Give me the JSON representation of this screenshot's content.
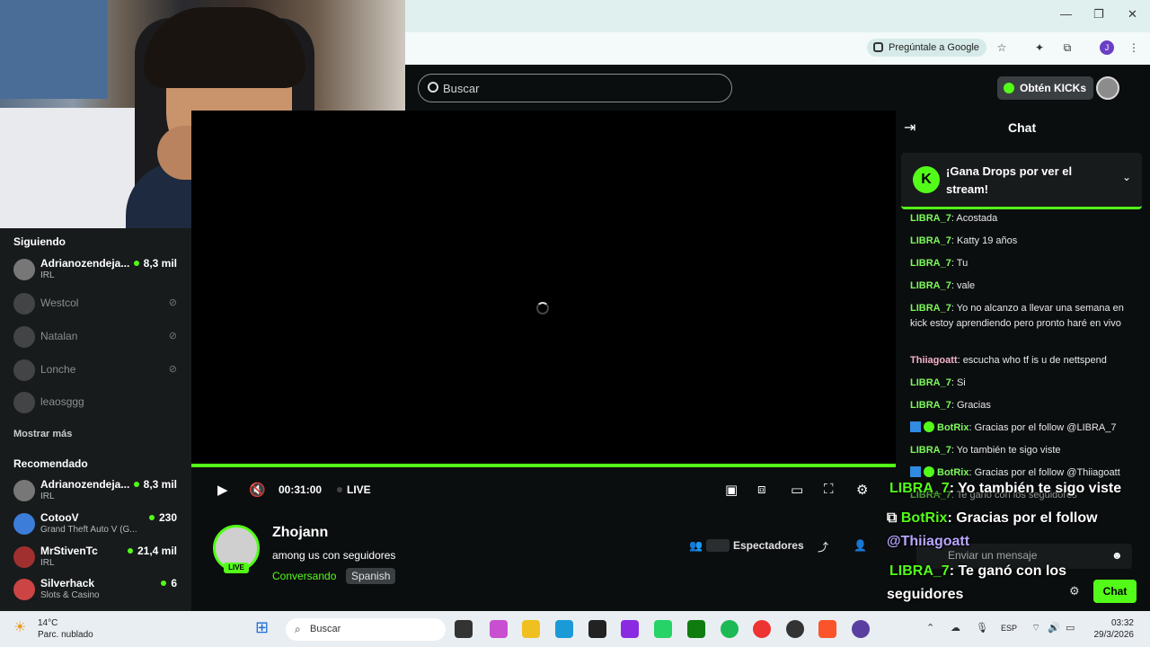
{
  "browser": {
    "ask_google": "Pregúntale a Google",
    "profile_initial": "J"
  },
  "topnav": {
    "search_placeholder": "Buscar",
    "kicks_button": "Obtén KICKs"
  },
  "sidebar": {
    "following_title": "Siguiendo",
    "following": [
      {
        "name": "Adrianozendeja...",
        "category": "IRL",
        "viewers": "8,3 mil",
        "live": true
      },
      {
        "name": "Westcol",
        "live": false
      },
      {
        "name": "Natalan",
        "live": false
      },
      {
        "name": "Lonche",
        "live": false
      },
      {
        "name": "leaosggg",
        "live": false
      }
    ],
    "show_more": "Mostrar más",
    "recommended_title": "Recomendado",
    "recommended": [
      {
        "name": "Adrianozendeja...",
        "category": "IRL",
        "viewers": "8,3 mil"
      },
      {
        "name": "CotooV",
        "category": "Grand Theft Auto V (G...",
        "viewers": "230"
      },
      {
        "name": "MrStivenTc",
        "category": "IRL",
        "viewers": "21,4 mil"
      },
      {
        "name": "Silverhack",
        "category": "Slots & Casino",
        "viewers": "6"
      }
    ]
  },
  "player": {
    "time": "00:31:00",
    "live_label": "LIVE",
    "progress": 1.0
  },
  "stream": {
    "streamer": "Zhojann",
    "live_badge": "LIVE",
    "title": "among us con seguidores",
    "category": "Conversando",
    "language": "Spanish",
    "viewers_label": "Espectadores"
  },
  "chat": {
    "title": "Chat",
    "drops_text": "¡Gana Drops por ver el stream!",
    "messages": [
      {
        "user": "LIBRA_7",
        "text": "Acostada"
      },
      {
        "user": "LIBRA_7",
        "text": "Katty 19 años"
      },
      {
        "user": "LIBRA_7",
        "text": "Tu"
      },
      {
        "user": "LIBRA_7",
        "text": "vale"
      },
      {
        "user": "LIBRA_7",
        "text": "Yo no alcanzo a llevar una semana en kick estoy aprendiendo pero pronto haré en vivo"
      },
      {
        "user": "Thiiagoatt",
        "text": "escucha who tf is u de nettspend"
      },
      {
        "user": "LIBRA_7",
        "text": "Si"
      },
      {
        "user": "LIBRA_7",
        "text": "Gracias"
      },
      {
        "user": "BotRix",
        "text": "Gracias por el follow @LIBRA_7"
      },
      {
        "user": "LIBRA_7",
        "text": "Yo también te sigo viste"
      },
      {
        "user": "BotRix",
        "text": "Gracias por el follow @Thiiagoatt"
      },
      {
        "user": "LIBRA_7",
        "text": "Te ganó con los seguidores"
      }
    ],
    "input_placeholder": "Enviar un mensaje",
    "send_button": "Chat"
  },
  "overlay": {
    "line1_user": "LIBRA_7",
    "line1_text": ": Yo también te sigo viste",
    "line2_user": "BotRix",
    "line2_text": ": Gracias por el follow",
    "line2_mention": "@Thiiagoatt",
    "line3_user": "LIBRA_7",
    "line3_text": ": Te ganó con los",
    "line3_text2": "seguidores"
  },
  "taskbar": {
    "temperature": "14°C",
    "weather": "Parc. nublado",
    "search": "Buscar",
    "language": "ESP",
    "time": "03:32",
    "date": "29/3/2026"
  },
  "colors": {
    "accent": "#53fc18",
    "background": "#0b0e0f",
    "sidebar": "#181b1c"
  }
}
